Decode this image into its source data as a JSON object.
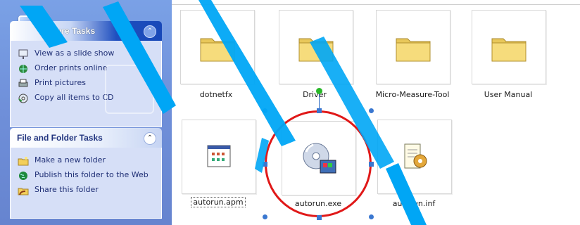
{
  "picture_tasks": {
    "title": "Picture Tasks",
    "items": [
      {
        "label": "View as a slide show",
        "icon": "slideshow-icon"
      },
      {
        "label": "Order prints online",
        "icon": "globe-print-icon"
      },
      {
        "label": "Print pictures",
        "icon": "printer-icon"
      },
      {
        "label": "Copy all items to CD",
        "icon": "cd-copy-icon"
      }
    ]
  },
  "file_folder_tasks": {
    "title": "File and Folder Tasks",
    "items": [
      {
        "label": "Make a new folder",
        "icon": "new-folder-icon"
      },
      {
        "label": "Publish this folder to the Web",
        "icon": "publish-web-icon"
      },
      {
        "label": "Share this folder",
        "icon": "share-folder-icon"
      }
    ]
  },
  "files": [
    {
      "name": "dotnetfx",
      "type": "folder"
    },
    {
      "name": "Driver",
      "type": "folder"
    },
    {
      "name": "Micro-Measure-Tool",
      "type": "folder"
    },
    {
      "name": "User Manual",
      "type": "folder"
    },
    {
      "name": "autorun.apm",
      "type": "apm-file"
    },
    {
      "name": "autorun.exe",
      "type": "exe-file"
    },
    {
      "name": "autorun.inf",
      "type": "inf-file"
    }
  ],
  "colors": {
    "highlight_ring": "#e01818",
    "watermark": "#00a6f5",
    "handles": "#3a77d0"
  }
}
